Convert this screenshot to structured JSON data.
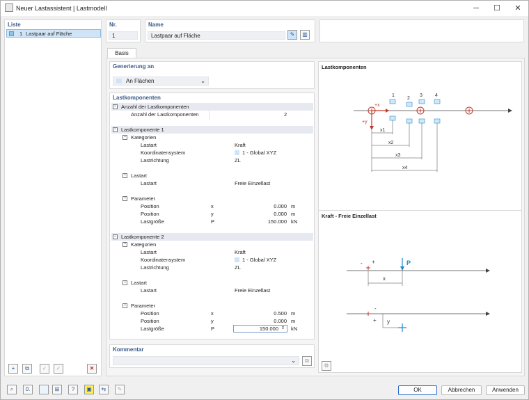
{
  "title": "Neuer Lastassistent | Lastmodell",
  "list": {
    "header": "Liste",
    "items": [
      {
        "num": "1",
        "label": "Lastpaar auf Fläche"
      }
    ]
  },
  "nr": {
    "label": "Nr.",
    "value": "1"
  },
  "name": {
    "label": "Name",
    "value": "Lastpaar auf Fläche"
  },
  "tabs": [
    {
      "label": "Basis"
    }
  ],
  "generation": {
    "label": "Generierung an",
    "value": "An Flächen"
  },
  "load_components": {
    "label": "Lastkomponenten",
    "count_group": "Anzahl der Lastkomponenten",
    "count_label": "Anzahl der Lastkomponenten",
    "count_value": "2",
    "comp1": "Lastkomponente 1",
    "comp2": "Lastkomponente 2",
    "categories": "Kategorien",
    "lastart": "Lastart",
    "kraft": "Kraft",
    "coord_label": "Koordinatensystem",
    "coord_value": "1 - Global XYZ",
    "dir_label": "Lastrichtung",
    "dir_value": "ZL",
    "lastart_group": "Lastart",
    "freie": "Freie Einzellast",
    "parameter": "Parameter",
    "position": "Position",
    "lastgroesse": "Lastgröße",
    "sym_x": "x",
    "sym_y": "y",
    "sym_p": "P",
    "c1_x": "0.000",
    "c1_y": "0.000",
    "c1_p": "150.000",
    "c2_x": "0.500",
    "c2_y": "0.000",
    "c2_p": "150.000",
    "unit_m": "m",
    "unit_kn": "kN"
  },
  "comment": {
    "label": "Kommentar"
  },
  "diagram1": {
    "title": "Lastkomponenten",
    "nums": [
      "1",
      "2",
      "3",
      "4"
    ],
    "px": "+x",
    "py": "+y",
    "x1": "x1",
    "x2": "x2",
    "x3": "x3",
    "x4": "x4"
  },
  "diagram2": {
    "title": "Kraft - Freie Einzellast",
    "p": "P",
    "x": "x",
    "y": "y",
    "minus": "-",
    "plus": "+"
  },
  "buttons": {
    "ok": "OK",
    "cancel": "Abbrechen",
    "apply": "Anwenden"
  },
  "colors": {
    "accent": "#3b5a8a",
    "red": "#c0392b",
    "blue": "#1e88c8",
    "selected": "#cfe5f7"
  }
}
